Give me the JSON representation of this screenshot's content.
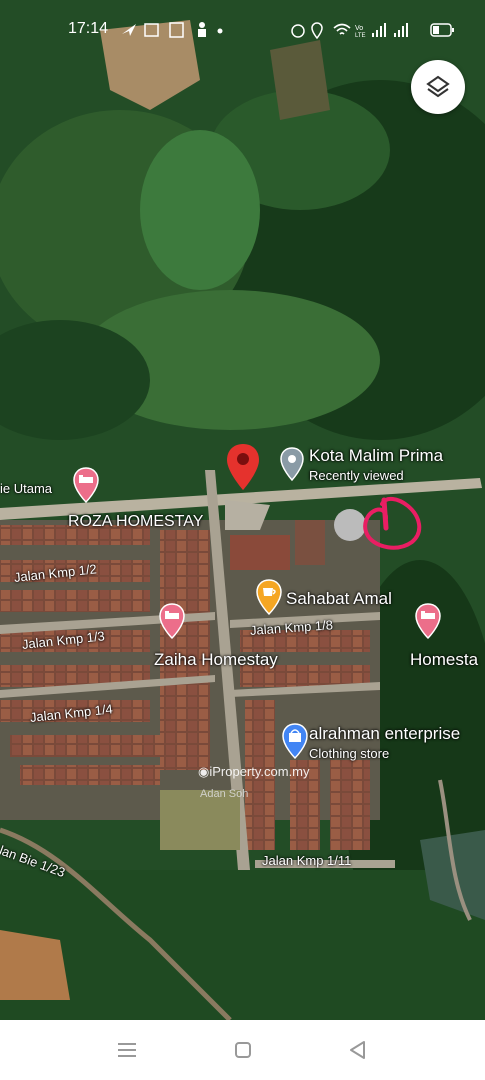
{
  "status_bar": {
    "time": "17:14",
    "left_icons": [
      "navigation-arrow-icon",
      "image-icon",
      "calendar-icon",
      "person-icon",
      "dot-icon"
    ],
    "right_icons": [
      "alarm-icon",
      "location-icon",
      "wifi-icon",
      "volte-icon",
      "signal-icon",
      "signal-icon",
      "battery-icon"
    ]
  },
  "map": {
    "layers_button_icon": "layers-icon",
    "streets": {
      "bie_utama": "ie Utama",
      "kmp_1_2": "Jalan Kmp 1/2",
      "kmp_1_3": "Jalan Kmp 1/3",
      "kmp_1_4": "Jalan Kmp 1/4",
      "kmp_1_8": "Jalan Kmp 1/8",
      "kmp_1_11": "Jalan Kmp 1/11",
      "bie_1_23": "lan Bie 1/23"
    },
    "places": {
      "kota_malim_prima": {
        "name": "Kota Malim Prima",
        "subtitle": "Recently viewed"
      },
      "roza_homestay": {
        "name": "ROZA HOMESTAY"
      },
      "sahabat_amal": {
        "name": "Sahabat Amal"
      },
      "zaiha_homestay": {
        "name": "Zaiha Homestay"
      },
      "homestay_right": {
        "name": "Homesta"
      },
      "alrahman": {
        "name": "alrahman enterprise",
        "subtitle": "Clothing store"
      }
    },
    "watermark": {
      "site": "iProperty.com.my",
      "author": "Adan Soh"
    },
    "colors": {
      "pin_red": "#e5322d",
      "poi_pink": "#ec6e8a",
      "cafe_orange": "#f5a623",
      "shop_blue": "#4285f4",
      "grey_pin": "#8a9ba6",
      "annotation_pink": "#e91e63"
    }
  },
  "nav_bar": {
    "icons": [
      "menu-icon",
      "home-icon",
      "back-icon"
    ]
  }
}
